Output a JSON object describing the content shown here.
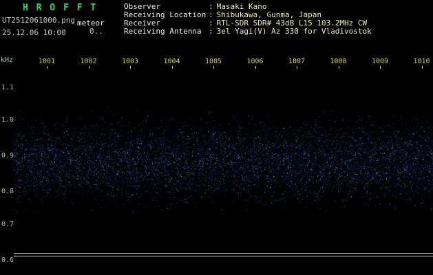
{
  "header": {
    "title": "H R O F F T",
    "filename": "UT2512061000.png",
    "mode_label": "meteor",
    "timestamp": "25.12.06 10:00",
    "dots": "0.."
  },
  "station": {
    "separator": ":",
    "rows": [
      {
        "label": "Observer",
        "value": "Masaki Kano"
      },
      {
        "label": "Receiving Location",
        "value": "Shibukawa, Gunma, Japan"
      },
      {
        "label": "Receiver",
        "value": "RTL-SDR SDR# 43dB L15 103.2MHz CW"
      },
      {
        "label": "Receiving Antenna",
        "value": "3el Yagi(V) Az 330 for Vladivostok"
      }
    ]
  },
  "colors": {
    "bg": "#000000",
    "title-green": "#22d966",
    "bright-white": "#efefef",
    "dim-white": "#c9c9c9",
    "value-yellow": "#eeeebb",
    "axis-label": "#a9c3a9",
    "axis-yellow": "#d3d35a",
    "tick": "#cfcfcf",
    "trace-upper": "#b5b5b5",
    "trace-lower": "#d0d0d0"
  },
  "chart_data": {
    "type": "heatmap",
    "x_tick_labels": [
      "1001",
      "1002",
      "1003",
      "1004",
      "1005",
      "1006",
      "1007",
      "1008",
      "1009",
      "1010"
    ],
    "y_unit": "kHz",
    "y_tick_labels": [
      "1.1",
      "1.0",
      "0.9",
      "0.8",
      "0.7",
      "0.6"
    ],
    "y_range_khz": [
      0.55,
      1.17
    ],
    "meteor_echoes": [],
    "signal_level_trace": "flat",
    "noise_band": {
      "center_khz": 0.885,
      "sigma_khz": 0.055,
      "dot_count": 20000,
      "sparse_count": 400,
      "palette": [
        "#081233",
        "#0d1f52",
        "#123070",
        "#1d4aa0",
        "#3a66c8",
        "#6f97e8",
        "#aac4ff"
      ]
    }
  }
}
